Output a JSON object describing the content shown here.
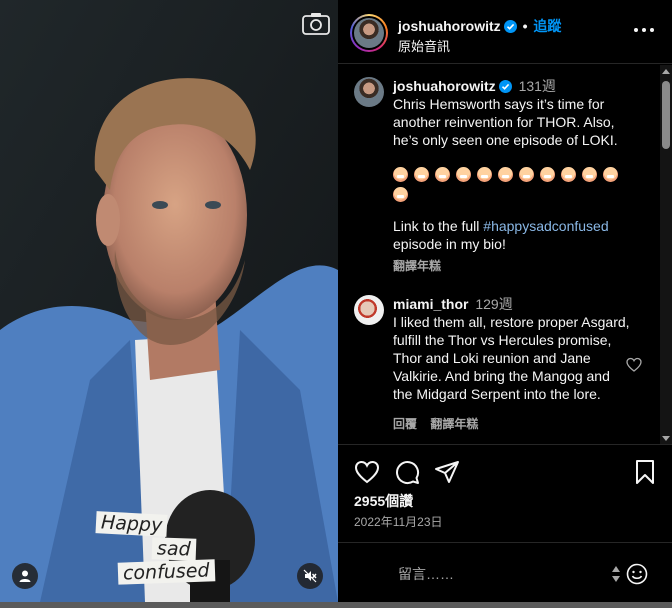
{
  "post": {
    "author": "joshuahorowitz",
    "follow_label": "追蹤",
    "audio_label": "原始音訊",
    "dot": "•"
  },
  "media": {
    "caption_lines": [
      "Happy",
      "sad",
      "confused"
    ]
  },
  "caption": {
    "user": "joshuahorowitz",
    "time": "131週",
    "text": "Chris Hemsworth says it’s time for another reinvention for THOR. Also, he’s only seen one episode of LOKI.",
    "emoji_count": 12,
    "link_prefix": "Link to the full ",
    "hashtag": "#happysadconfused",
    "link_suffix": " episode in my bio!",
    "translate_label": "翻譯年糕"
  },
  "comments": [
    {
      "user": "miami_thor",
      "time": "129週",
      "text": "I liked them all, restore proper Asgard, fulfill the Thor vs Hercules promise, Thor and Loki reunion and Jane Valkirie. And bring the Mangog and the Midgard Serpent into the lore.",
      "reply_label": "回覆",
      "translate_label": "翻譯年糕"
    }
  ],
  "stats": {
    "views": "2955個讚",
    "date": "2022年11月23日"
  },
  "composer": {
    "placeholder": "留言……"
  },
  "colors": {
    "link": "#0095f6",
    "hashtag": "#8ab8e6",
    "muted": "#a8a8a8",
    "jacket": "#4f7fc0"
  },
  "icons": {
    "camera": "camera-icon",
    "user_tag": "user-tag-icon",
    "mute": "mute-icon",
    "like": "heart-icon",
    "comment": "comment-icon",
    "share": "send-icon",
    "save": "bookmark-icon",
    "more": "more-icon",
    "emoji": "emoji-icon"
  }
}
